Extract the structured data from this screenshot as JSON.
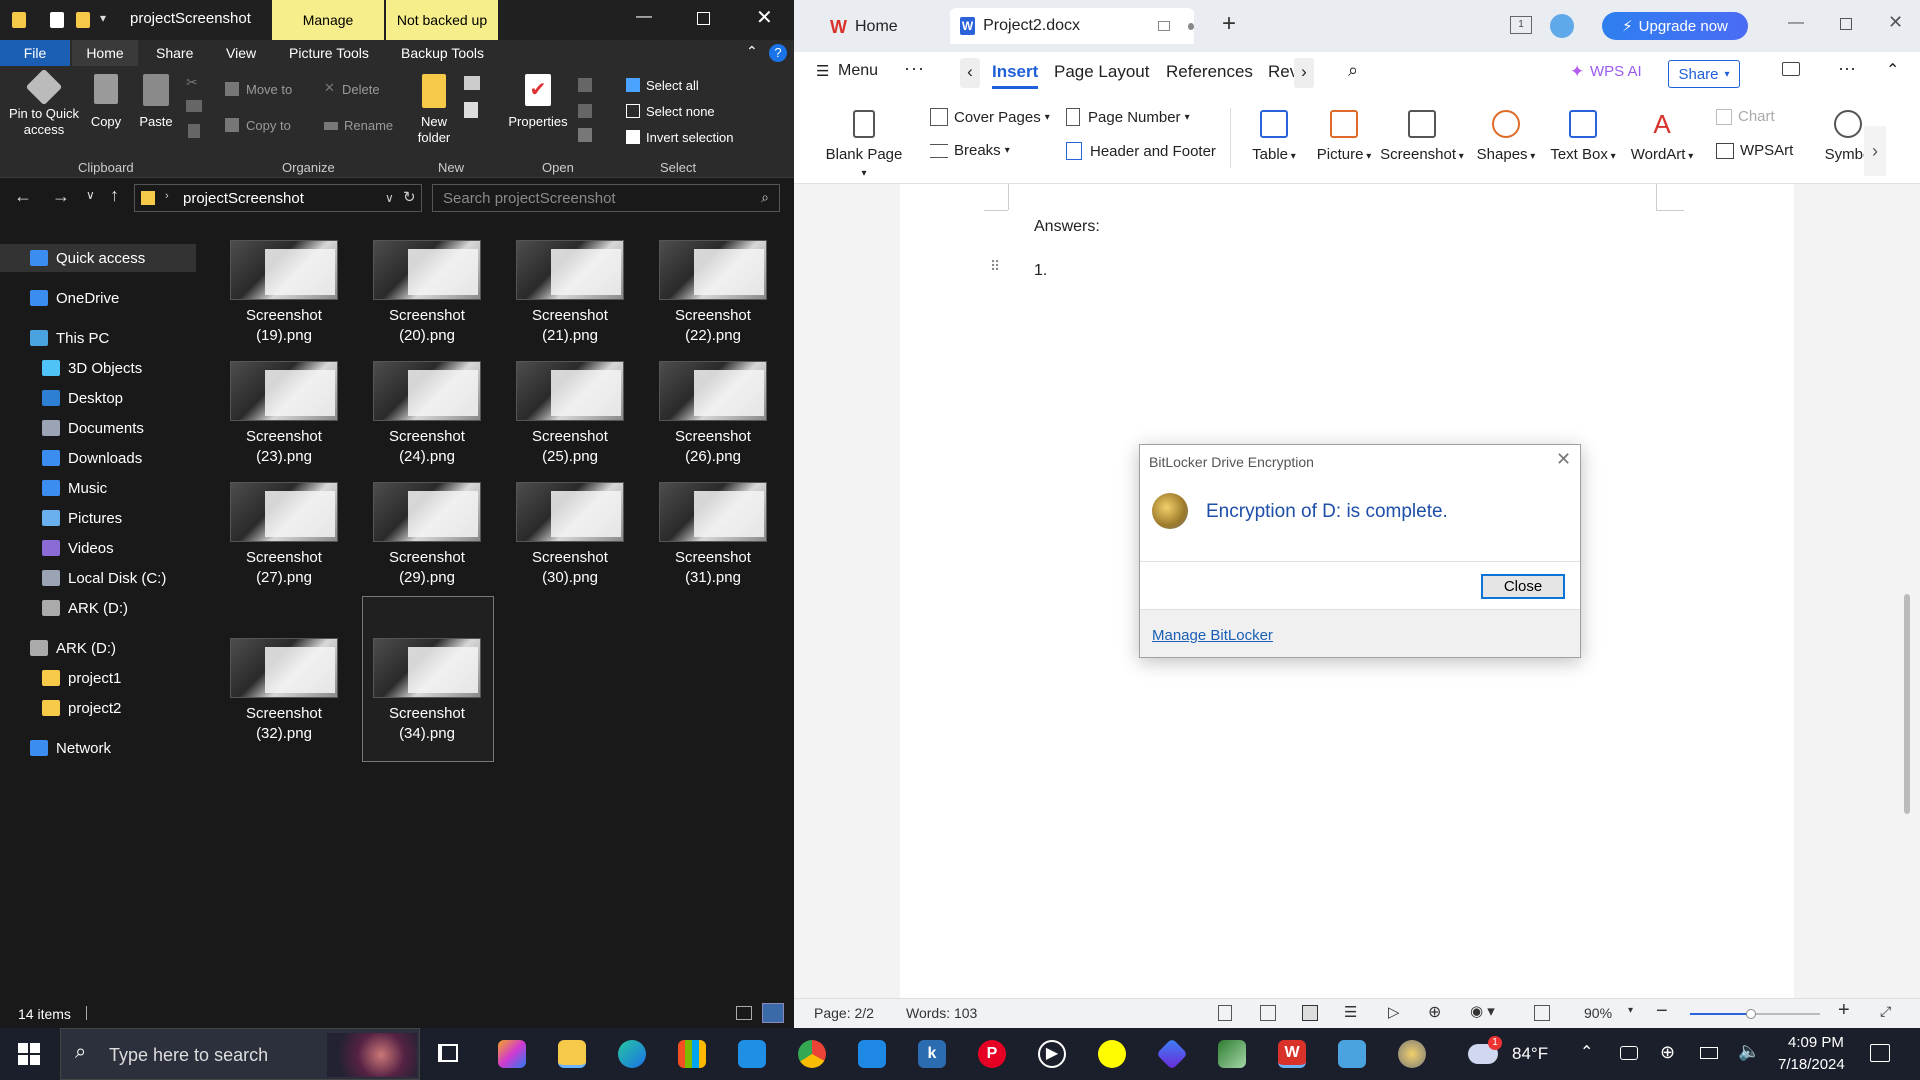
{
  "explorer": {
    "window_title": "projectScreenshot",
    "context_tabs": {
      "manage": "Manage",
      "not_backed_up": "Not backed up"
    },
    "tabs": [
      "File",
      "Home",
      "Share",
      "View",
      "Picture Tools",
      "Backup Tools"
    ],
    "ribbon": {
      "pin_to_quick_access": "Pin to Quick access",
      "copy": "Copy",
      "paste": "Paste",
      "move_to": "Move to",
      "copy_to": "Copy to",
      "delete": "Delete",
      "rename": "Rename",
      "new_folder": "New folder",
      "properties": "Properties",
      "select_all": "Select all",
      "select_none": "Select none",
      "invert_selection": "Invert selection",
      "groups": [
        "Clipboard",
        "Organize",
        "New",
        "Open",
        "Select"
      ]
    },
    "address": {
      "path": "projectScreenshot",
      "search_placeholder": "Search projectScreenshot"
    },
    "nav": [
      {
        "label": "Quick access",
        "icon": "star-icon",
        "indent": 0
      },
      {
        "label": "OneDrive",
        "icon": "cloud-icon",
        "indent": 0
      },
      {
        "label": "This PC",
        "icon": "pc-icon",
        "indent": 0
      },
      {
        "label": "3D Objects",
        "icon": "cube-icon",
        "indent": 1
      },
      {
        "label": "Desktop",
        "icon": "desktop-icon",
        "indent": 1
      },
      {
        "label": "Documents",
        "icon": "document-icon",
        "indent": 1
      },
      {
        "label": "Downloads",
        "icon": "download-icon",
        "indent": 1
      },
      {
        "label": "Music",
        "icon": "music-icon",
        "indent": 1
      },
      {
        "label": "Pictures",
        "icon": "picture-icon",
        "indent": 1
      },
      {
        "label": "Videos",
        "icon": "video-icon",
        "indent": 1
      },
      {
        "label": "Local Disk (C:)",
        "icon": "disk-icon",
        "indent": 1
      },
      {
        "label": "ARK (D:)",
        "icon": "drive-icon",
        "indent": 1
      },
      {
        "label": "ARK (D:)",
        "icon": "drive-icon",
        "indent": 0
      },
      {
        "label": "project1",
        "icon": "folder-icon",
        "indent": 1
      },
      {
        "label": "project2",
        "icon": "folder-icon",
        "indent": 1
      },
      {
        "label": "Network",
        "icon": "network-icon",
        "indent": 0
      }
    ],
    "files": [
      {
        "line1": "Screenshot",
        "line2": "(19).png"
      },
      {
        "line1": "Screenshot",
        "line2": "(20).png"
      },
      {
        "line1": "Screenshot",
        "line2": "(21).png"
      },
      {
        "line1": "Screenshot",
        "line2": "(22).png"
      },
      {
        "line1": "Screenshot",
        "line2": "(23).png"
      },
      {
        "line1": "Screenshot",
        "line2": "(24).png"
      },
      {
        "line1": "Screenshot",
        "line2": "(25).png"
      },
      {
        "line1": "Screenshot",
        "line2": "(26).png"
      },
      {
        "line1": "Screenshot",
        "line2": "(27).png"
      },
      {
        "line1": "Screenshot",
        "line2": "(29).png"
      },
      {
        "line1": "Screenshot",
        "line2": "(30).png"
      },
      {
        "line1": "Screenshot",
        "line2": "(31).png"
      },
      {
        "line1": "Screenshot",
        "line2": "(32).png"
      },
      {
        "line1": "Screenshot",
        "line2": "(34).png"
      }
    ],
    "status": "14 items"
  },
  "wps": {
    "tabs": {
      "home": "Home",
      "doc": "Project2.docx"
    },
    "upgrade": "Upgrade now",
    "menu": {
      "menu": "Menu",
      "tabs": [
        "Insert",
        "Page Layout",
        "References",
        "Rev"
      ],
      "wps_ai": "WPS AI",
      "share": "Share"
    },
    "toolbar": {
      "blank_page": "Blank Page",
      "cover_pages": "Cover Pages",
      "breaks": "Breaks",
      "page_number": "Page Number",
      "header_footer": "Header and Footer",
      "table": "Table",
      "picture": "Picture",
      "screenshot": "Screenshot",
      "shapes": "Shapes",
      "text_box": "Text Box",
      "wordart": "WordArt",
      "chart": "Chart",
      "wpsart": "WPSArt",
      "symbol": "Symbo"
    },
    "doc": {
      "answers": "Answers:",
      "item1": "1."
    },
    "status": {
      "page": "Page: 2/2",
      "words": "Words: 103",
      "zoom": "90%"
    }
  },
  "dialog": {
    "title": "BitLocker Drive Encryption",
    "message": "Encryption of D: is complete.",
    "close": "Close",
    "manage_link": "Manage BitLocker"
  },
  "taskbar": {
    "search_placeholder": "Type here to search",
    "weather": "84°F",
    "time": "4:09 PM",
    "date": "7/18/2024",
    "badge": "1"
  },
  "colors": {
    "accent": "#0b74d6",
    "ribbon_ctx": "#f6ee8a",
    "wps_red": "#d9322b",
    "dialog_text": "#1e4ea8"
  }
}
